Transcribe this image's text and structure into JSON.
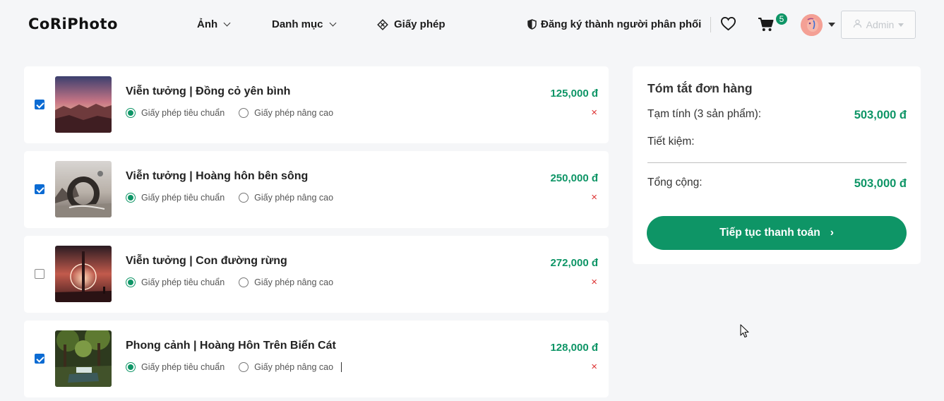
{
  "header": {
    "logo": "CoRiPhoto",
    "nav": [
      {
        "label": "Ảnh"
      },
      {
        "label": "Danh mục"
      },
      {
        "label": "Giấy phép"
      }
    ],
    "distributor_label": "Đăng ký thành người phân phối",
    "cart_count": "5",
    "admin_label": "Admin",
    "icons": {
      "license": "diamond-grid-icon",
      "distributor": "half-shield-icon",
      "wishlist": "heart-icon",
      "cart": "cart-icon",
      "admin": "user-icon"
    }
  },
  "cart": {
    "license_standard": "Giấy phép tiêu chuẩn",
    "license_advanced": "Giấy phép nâng cao",
    "remove_symbol": "×",
    "items": [
      {
        "title": "Viễn tưởng | Đồng cỏ yên bình",
        "price": "125,000 đ",
        "checked": true,
        "license": "standard"
      },
      {
        "title": "Viễn tưởng | Hoàng hôn bên sông",
        "price": "250,000 đ",
        "checked": true,
        "license": "standard"
      },
      {
        "title": "Viễn tưởng | Con đường rừng",
        "price": "272,000 đ",
        "checked": false,
        "license": "standard"
      },
      {
        "title": "Phong cảnh | Hoàng Hôn Trên Biển Cát",
        "price": "128,000 đ",
        "checked": true,
        "license": "standard"
      }
    ]
  },
  "summary": {
    "title": "Tóm tắt đơn hàng",
    "subtotal_label": "Tạm tính (3 sản phẩm):",
    "subtotal_value": "503,000 đ",
    "savings_label": "Tiết kiệm:",
    "total_label": "Tổng cộng:",
    "total_value": "503,000 đ",
    "checkout_label": "Tiếp tục thanh toán",
    "checkout_arrow": "›"
  },
  "colors": {
    "accent": "#0e9566",
    "remove": "#dd3333",
    "checkbox": "#0b6bd3",
    "background": "#f5f6f8"
  }
}
